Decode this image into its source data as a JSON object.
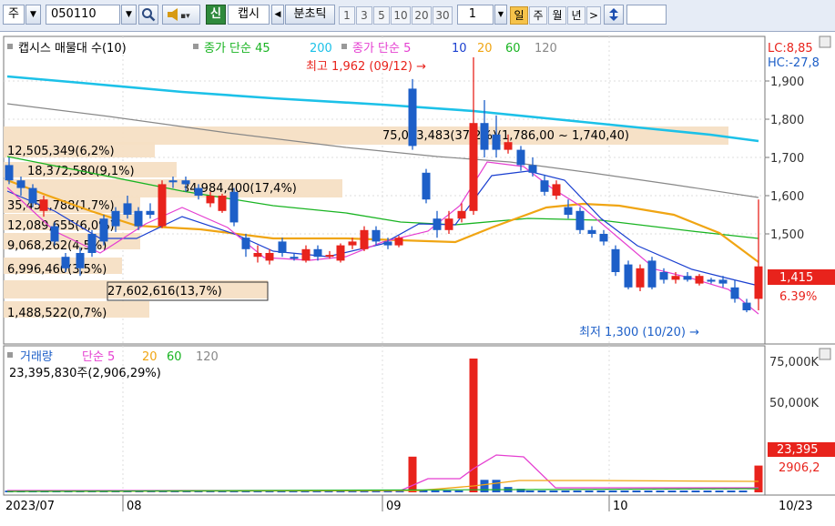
{
  "toolbar": {
    "market": "주",
    "code": "050110",
    "sin_label": "신",
    "name": "캡시",
    "period_label": "분초틱",
    "minute_buttons": [
      "1",
      "3",
      "5",
      "10",
      "20",
      "30"
    ],
    "count_value": "1",
    "period_tabs": [
      "일",
      "주",
      "월",
      "년"
    ],
    "active_tab": "일",
    "next_label": ">"
  },
  "price_panel": {
    "title": "캡시스 매물대 수(10)",
    "ma_title_1": "종가 단순 45",
    "ma_title_1b": "200",
    "ma_title_2": "종가 단순 5",
    "ma_periods": [
      "10",
      "20",
      "60",
      "120"
    ],
    "lc": "LC:8,85",
    "hc": "HC:-27,8",
    "high_note": "최고 1,962 (09/12) →",
    "low_note": "최저 1,300 (10/20) →",
    "current_price": "1,415",
    "current_change": "6.39%",
    "y_ticks": [
      "1,900",
      "1,800",
      "1,700",
      "1,600",
      "1,500"
    ],
    "volume_profile": [
      {
        "label": "75,043,483(37,2%)(1,786,00 ~ 1,740,40)"
      },
      {
        "label": "12,505,349(6,2%)"
      },
      {
        "label": "18,372,580(9,1%)"
      },
      {
        "label": "34,984,400(17,4%)"
      },
      {
        "label": "35,451,788(1,7%)"
      },
      {
        "label": "12,089,655(6,0%)"
      },
      {
        "label": "9,068,262(4,5%)"
      },
      {
        "label": "6,996,460(3,5%)"
      },
      {
        "label": "27,602,616(13,7%)"
      },
      {
        "label": "1,488,522(0,7%)"
      }
    ]
  },
  "volume_panel": {
    "title": "거래량",
    "ma_label": "단순 5",
    "ma_periods": [
      "20",
      "60",
      "120"
    ],
    "info": "23,395,830주(2,906,29%)",
    "current_volume": "23,395",
    "current_ratio": "2906,2",
    "y_ticks": [
      "75,000K",
      "50,000K"
    ]
  },
  "x_axis": {
    "labels": [
      "2023/07",
      "08",
      "09",
      "10",
      "10/23"
    ]
  },
  "colors": {
    "up": "#e8231c",
    "down": "#1d5fc8",
    "ma5": "#e53fd1",
    "ma10": "#1a3fd0",
    "ma20": "#f0a513",
    "ma60": "#19b422",
    "ma120": "#888888",
    "ma200": "#1cc1e8",
    "profile": "#f5dfc4"
  }
}
